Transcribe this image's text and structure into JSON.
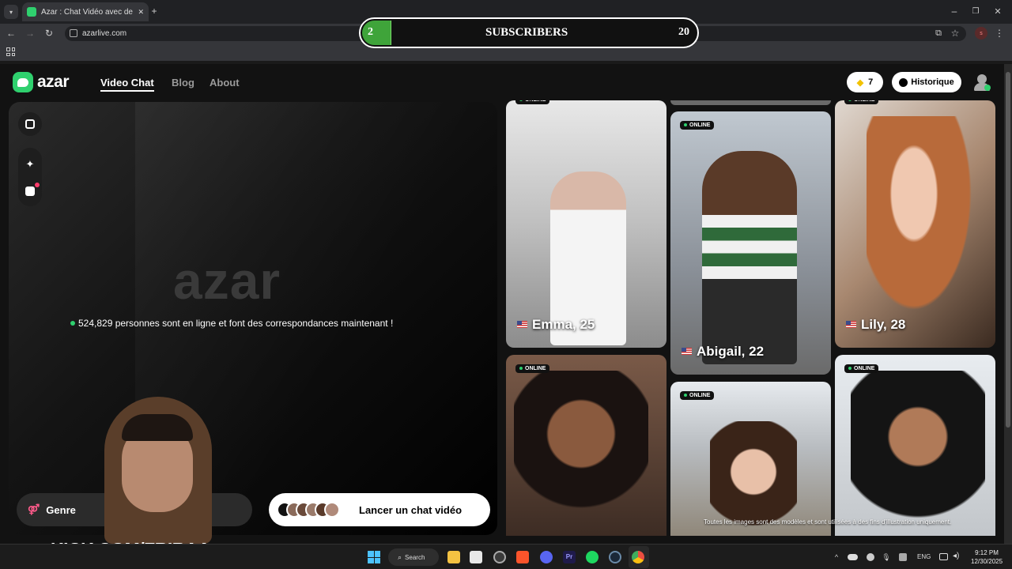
{
  "browser": {
    "tab_title": "Azar : Chat Vidéo avec de nouv",
    "url": "azarlive.com",
    "new_tab_glyph": "+",
    "profile_initial": "s"
  },
  "overlay": {
    "count_left": "2",
    "label": "SUBSCRIBERS",
    "goal": "20",
    "progress_fraction": 0.1,
    "kick_text": "KICK.COM/FRIRAA"
  },
  "header": {
    "logo": "azar",
    "nav": [
      "Video Chat",
      "Blog",
      "About"
    ],
    "gems": "7",
    "history_label": "Historique"
  },
  "hero": {
    "big_logo": "azar",
    "online_text": "524,829 personnes sont en ligne et font des correspondances maintenant !",
    "gender_label": "Genre",
    "start_label": "Lancer un chat vidéo"
  },
  "cards": {
    "online_label": "ONLINE",
    "names": [
      "Emma, 25",
      "Abigail, 22",
      "Lily, 28"
    ],
    "disclaimer": "Toutes les images sont des modèles et sont utilisées à des fins d'illustration uniquement."
  },
  "taskbar": {
    "search_label": "Search",
    "lang": "ENG",
    "time": "9:12 PM",
    "date": "12/30/2025"
  },
  "colors": {
    "brand_green": "#2fd06e",
    "sub_bar": "#3fa43a",
    "kick_green": "#53fc18"
  }
}
